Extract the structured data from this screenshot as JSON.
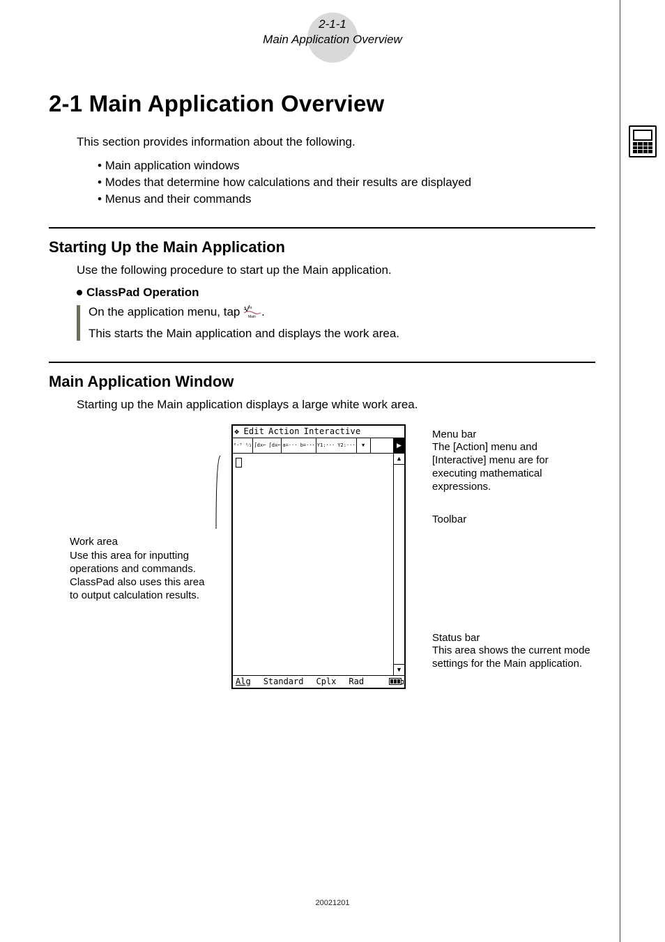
{
  "header": {
    "page_ref": "2-1-1",
    "page_title": "Main Application Overview"
  },
  "title": "2-1  Main Application Overview",
  "intro": "This section provides information about the following.",
  "intro_bullets": [
    "Main application windows",
    "Modes that determine how calculations and their results are displayed",
    "Menus and their commands"
  ],
  "section1": {
    "heading": "Starting Up the Main Application",
    "para": "Use the following procedure to start up the Main application.",
    "op_head": "ClassPad Operation",
    "step1_pre": "On the application menu, tap ",
    "step1_icon_alt": "Main",
    "step1_post": ".",
    "step2": "This starts the Main application and displays the work area."
  },
  "section2": {
    "heading": "Main Application Window",
    "para": "Starting up the Main application displays a large white work area."
  },
  "diagram": {
    "left": {
      "title": "Work area",
      "body": "Use this area for inputting operations and commands. ClassPad also uses this area to output calculation results."
    },
    "right": {
      "menubar_title": "Menu bar",
      "menubar_body": "The [Action] menu and [Interactive] menu are for executing mathematical expressions.",
      "toolbar": "Toolbar",
      "statusbar_title": "Status bar",
      "statusbar_body": "This area shows the current mode settings for the Main application."
    },
    "device": {
      "menubar": {
        "v": "❖",
        "edit": "Edit",
        "action": "Action",
        "interactive": "Interactive"
      },
      "toolbar_btns": [
        "⁰·⁵ ¹⁄₂",
        "∫dx⌐\n∫dx⌐",
        "a=···\nb=···",
        "Y1:···\nY2:···",
        "▼"
      ],
      "status": {
        "alg": "Alg",
        "standard": "Standard",
        "cplx": "Cplx",
        "rad": "Rad"
      }
    }
  },
  "footer_code": "20021201"
}
